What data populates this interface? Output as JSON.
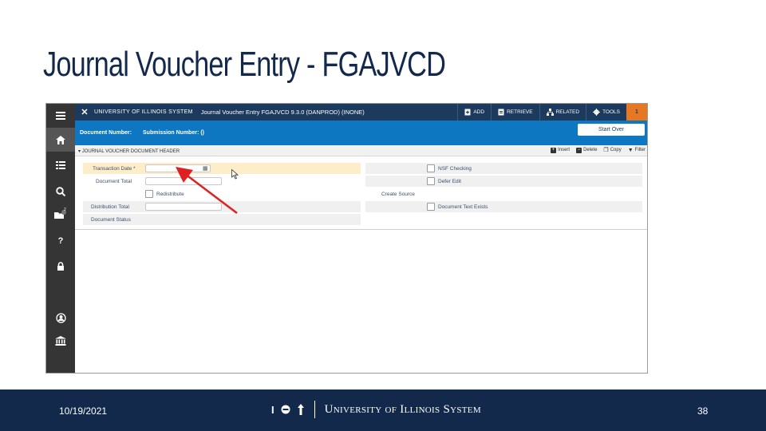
{
  "slide": {
    "title": "Journal Voucher Entry - FGAJVCD",
    "footer": {
      "date": "10/19/2021",
      "page_number": "38",
      "logo_text": "University of Illinois System"
    }
  },
  "app": {
    "topbar": {
      "close_glyph": "✕",
      "university": "UNIVERSITY OF ILLINOIS SYSTEM",
      "form_title": "Journal Voucher Entry FGAJVCD 9.3.0 (DANPROD) (INONE)",
      "buttons": [
        {
          "label": "ADD",
          "icon": "add-doc-icon"
        },
        {
          "label": "RETRIEVE",
          "icon": "retrieve-icon"
        },
        {
          "label": "RELATED",
          "icon": "related-icon"
        },
        {
          "label": "TOOLS",
          "icon": "gear-icon"
        }
      ],
      "badge": "1"
    },
    "docbar": {
      "document_number_label": "Document Number:",
      "submission_number_label": "Submission Number: ()",
      "start_over": "Start Over"
    },
    "section": {
      "title": "JOURNAL VOUCHER DOCUMENT HEADER",
      "actions": [
        {
          "label": "Insert",
          "icon": "plus-icon"
        },
        {
          "label": "Delete",
          "icon": "minus-icon"
        },
        {
          "label": "Copy",
          "icon": "copy-icon"
        },
        {
          "label": "Filter",
          "icon": "filter-icon"
        }
      ]
    },
    "form": {
      "transaction_date_label": "Transaction Date *",
      "document_total_label": "Document Total",
      "redistribute_label": "Redistribute",
      "distribution_total_label": "Distribution Total",
      "document_status_label": "Document Status",
      "nsf_checking_label": "NSF Checking",
      "defer_edit_label": "Defer Edit",
      "create_source_label": "Create Source",
      "document_text_exists_label": "Document Text Exists"
    },
    "leftnav": {
      "items": [
        "menu-icon",
        "home-icon",
        "grid-icon",
        "search-icon",
        "folder-icon",
        "help-icon",
        "lock-icon",
        "user-icon",
        "bank-icon"
      ],
      "folder_badge": "2"
    }
  },
  "colors": {
    "title": "#13294b",
    "footer_bg": "#13294b",
    "topbar": "#1c3a5e",
    "docbar": "#0d77c2",
    "accent_orange": "#e87722",
    "highlight_row": "#fdeec9",
    "arrow": "#e02020"
  }
}
